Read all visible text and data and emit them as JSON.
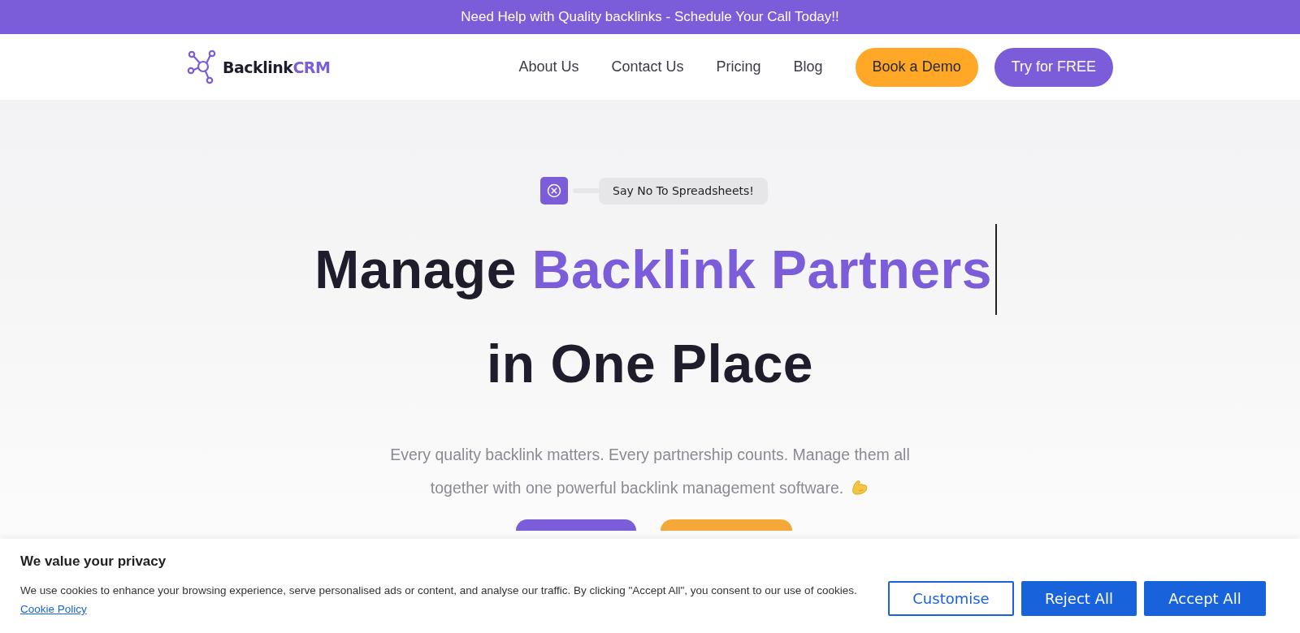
{
  "announcement_bar": {
    "text": "Need Help with Quality backlinks - Schedule Your Call Today!!"
  },
  "header": {
    "logo": {
      "text": "Backlink",
      "accent": "CRM"
    },
    "nav_links": [
      "About Us",
      "Contact Us",
      "Pricing",
      "Blog"
    ],
    "buttons": [
      {
        "label": "Book a Demo",
        "kind": "secondary"
      },
      {
        "label": "Try for FREE",
        "kind": "primary"
      }
    ]
  },
  "hero": {
    "badge": "Say No To Spreadsheets!",
    "heading_lines": [
      [
        {
          "text": "Manage",
          "accent": false
        },
        {
          "text": "Backlink Partners",
          "accent": true
        }
      ],
      [
        {
          "text": "in One Place",
          "accent": false
        }
      ]
    ],
    "text_cursor": true,
    "description": "Every quality backlink matters. Every partnership counts. Manage them all together with one powerful backlink management software.",
    "cta_buttons": [
      {
        "kind": "primary"
      },
      {
        "kind": "secondary"
      }
    ]
  },
  "cookie_banner": {
    "title": "We value your privacy",
    "text": "We use cookies to enhance your browsing experience, serve personalised ads or content, and analyse our traffic. By clicking \"Accept All\", you consent to our use of cookies.",
    "link": "Cookie Policy",
    "buttons": [
      {
        "label": "Customise",
        "kind": "outline"
      },
      {
        "label": "Reject All",
        "kind": "filled"
      },
      {
        "label": "Accept All",
        "kind": "filled"
      }
    ]
  }
}
